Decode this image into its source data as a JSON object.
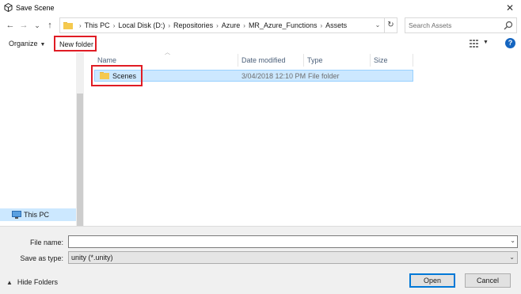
{
  "window": {
    "title": "Save Scene",
    "close_symbol": "✕"
  },
  "nav": {
    "back": "←",
    "forward": "→",
    "recent": "⌄",
    "up": "↑"
  },
  "address": {
    "breadcrumbs": [
      "This PC",
      "Local Disk (D:)",
      "Repositories",
      "Azure",
      "MR_Azure_Functions",
      "Assets"
    ],
    "dropdown_symbol": "⌄",
    "refresh_symbol": "↻"
  },
  "search": {
    "placeholder": "Search Assets"
  },
  "toolbar": {
    "organize_label": "Organize",
    "new_folder_label": "New folder",
    "help_symbol": "?"
  },
  "nav_pane": {
    "items": [
      {
        "label": "This PC",
        "icon": "computer-icon",
        "selected": true
      }
    ]
  },
  "file_list": {
    "columns": [
      "Name",
      "Date modified",
      "Type",
      "Size"
    ],
    "rows": [
      {
        "name": "Scenes",
        "date_modified": "3/04/2018 12:10 PM",
        "type": "File folder",
        "size": "",
        "icon": "folder-icon",
        "selected": true
      }
    ]
  },
  "save_form": {
    "file_name_label": "File name:",
    "file_name_value": "",
    "save_as_type_label": "Save as type:",
    "save_as_type_value": "unity (*.unity)"
  },
  "footer": {
    "hide_folders_label": "Hide Folders",
    "open_button": "Open",
    "cancel_button": "Cancel"
  },
  "colors": {
    "accent": "#0078d7",
    "selection": "#cce8ff",
    "highlight_box": "#e01c24",
    "folder": "#f5c94e"
  }
}
